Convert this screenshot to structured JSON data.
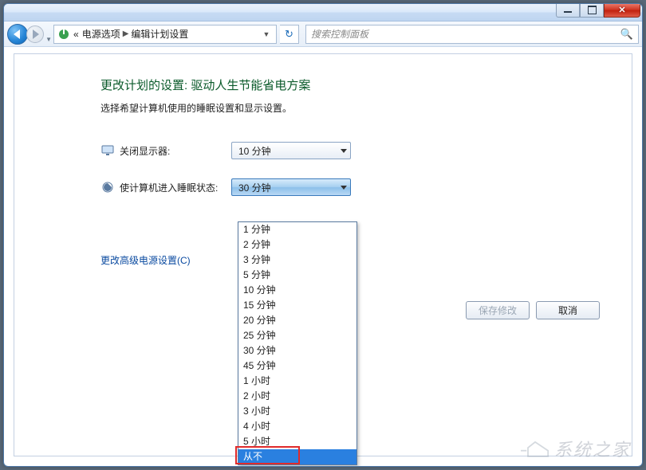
{
  "breadcrumb": {
    "prefix": "«",
    "part1": "电源选项",
    "part2": "编辑计划设置"
  },
  "search": {
    "placeholder": "搜索控制面板"
  },
  "heading": "更改计划的设置: 驱动人生节能省电方案",
  "subtext": "选择希望计算机使用的睡眠设置和显示设置。",
  "row_display": {
    "label": "关闭显示器:",
    "value": "10 分钟"
  },
  "row_sleep": {
    "label": "使计算机进入睡眠状态:",
    "value": "30 分钟"
  },
  "link_advanced": "更改高级电源设置(C)",
  "buttons": {
    "save": "保存修改",
    "cancel": "取消"
  },
  "dropdown_options": [
    "1 分钟",
    "2 分钟",
    "3 分钟",
    "5 分钟",
    "10 分钟",
    "15 分钟",
    "20 分钟",
    "25 分钟",
    "30 分钟",
    "45 分钟",
    "1 小时",
    "2 小时",
    "3 小时",
    "4 小时",
    "5 小时",
    "从不"
  ],
  "dropdown_highlight_index": 15,
  "watermark": "系统之家"
}
